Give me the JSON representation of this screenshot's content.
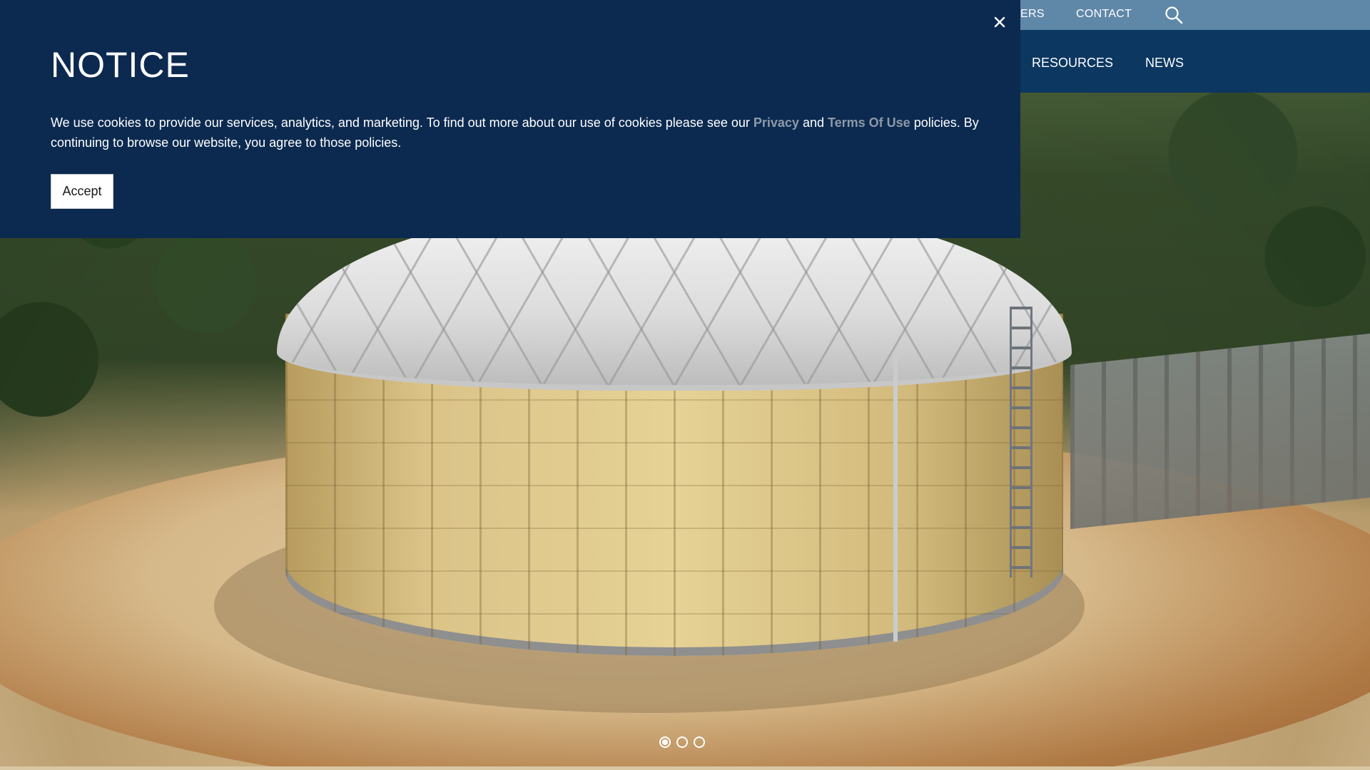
{
  "header": {
    "utility_links": [
      {
        "label": "ERS"
      },
      {
        "label": "CONTACT"
      }
    ],
    "search_icon": "search-icon",
    "nav_links": [
      {
        "label": "RESOURCES"
      },
      {
        "label": "NEWS"
      }
    ]
  },
  "notice": {
    "title": "NOTICE",
    "text_before": "We use cookies to provide our services, analytics, and marketing. To find out more about our use of cookies please see our ",
    "privacy_link": "Privacy",
    "text_between": " and ",
    "terms_link": "Terms Of Use",
    "text_after": " policies. By continuing to browse our website, you agree to those policies.",
    "accept_label": "Accept",
    "close_icon": "close-icon"
  },
  "slider": {
    "slide_count": 3,
    "active_index": 0
  },
  "colors": {
    "notice_bg": "#0c2a50",
    "utility_bar_bg": "#5f87a8",
    "main_nav_bg": "#0c3761",
    "link_muted": "#8d99a8"
  }
}
